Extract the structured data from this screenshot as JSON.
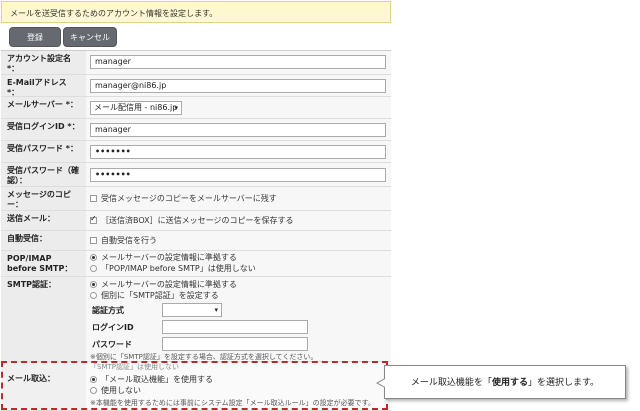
{
  "info_message": "メールを送受信するためのアカウント情報を設定します。",
  "buttons": {
    "save": "登録",
    "cancel": "キャンセル"
  },
  "fields": {
    "account_name": {
      "label": "アカウント設定名 *：",
      "value": "manager"
    },
    "email": {
      "label": "E-Mailアドレス *：",
      "value": "manager@ni86.jp"
    },
    "mail_server": {
      "label": "メールサーバー *：",
      "value": "メール配信用 - ni86.jp"
    },
    "login_id": {
      "label": "受信ログインID *：",
      "value": "manager"
    },
    "password": {
      "label": "受信パスワード *：",
      "value": "•••••••"
    },
    "password_confirm": {
      "label": "受信パスワード（確認）：",
      "value": "•••••••"
    },
    "copy_message": {
      "label": "メッセージのコピー：",
      "option": "受信メッセージのコピーをメールサーバーに残す",
      "checked": false
    },
    "send_mail": {
      "label": "送信メール：",
      "option": "［送信済BOX］に送信メッセージのコピーを保存する",
      "checked": true
    },
    "auto_receive": {
      "label": "自動受信：",
      "option": "自動受信を行う",
      "checked": false
    },
    "pop_before_smtp": {
      "label": "POP/IMAP before SMTP：",
      "options": [
        "メールサーバーの設定情報に準拠する",
        "「POP/IMAP before SMTP」は使用しない"
      ],
      "selected": 0
    },
    "smtp_auth": {
      "label": "SMTP認証：",
      "options": [
        "メールサーバーの設定情報に準拠する",
        "個別に「SMTP認証」を設定する"
      ],
      "selected": 0,
      "auth_method_label": "認証方式",
      "login_id_label": "ログインID",
      "password_label": "パスワード",
      "note1": "※個別に「SMTP認証」を設定する場合、認証方式を選択してください。",
      "note2": "「SMTP認証」は使用しない"
    },
    "mail_fetch": {
      "label": "メール取込：",
      "options": [
        "「メール取込機能」を使用する",
        "使用しない"
      ],
      "selected": 0,
      "note": "※本機能を使用するためには事前にシステム設定「メール取込ルール」の設定が必要です。"
    }
  },
  "callout": {
    "prefix": "メール取込機能を「",
    "bold": "使用する",
    "suffix": "」を選択します。"
  },
  "colors": {
    "highlight_border": "#c0272d",
    "info_bg": "#fdf8cf",
    "button_bg": "#666a70"
  }
}
